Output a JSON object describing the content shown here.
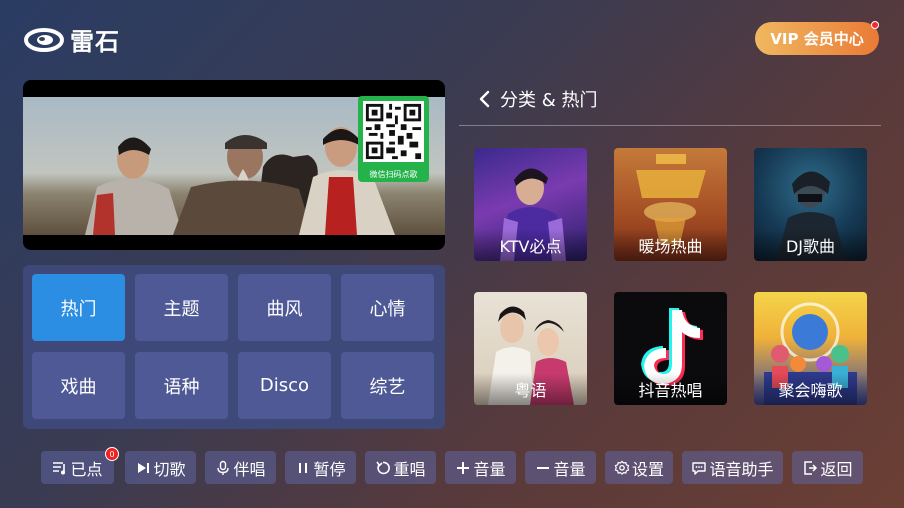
{
  "brand": {
    "name": "雷石"
  },
  "vip": {
    "label": "VIP 会员中心"
  },
  "qr": {
    "caption": "微信扫码点歌"
  },
  "categories": [
    {
      "label": "热门",
      "active": true
    },
    {
      "label": "主题"
    },
    {
      "label": "曲风"
    },
    {
      "label": "心情"
    },
    {
      "label": "戏曲"
    },
    {
      "label": "语种"
    },
    {
      "label": "Disco"
    },
    {
      "label": "综艺"
    }
  ],
  "section": {
    "title": "分类 & 热门"
  },
  "tiles": [
    {
      "label": "KTV必点"
    },
    {
      "label": "暖场热曲"
    },
    {
      "label": "DJ歌曲"
    },
    {
      "label": "粤语"
    },
    {
      "label": "抖音热唱"
    },
    {
      "label": "聚会嗨歌"
    }
  ],
  "toolbar": {
    "queued_label": "已点",
    "queued_count": "0",
    "skip_label": "切歌",
    "accompany_label": "伴唱",
    "pause_label": "暂停",
    "replay_label": "重唱",
    "vol_up_label": "音量",
    "vol_down_label": "音量",
    "settings_label": "设置",
    "voice_label": "语音助手",
    "back_label": "返回"
  },
  "colors": {
    "accent": "#2c8ee3",
    "vip_start": "#f0b860",
    "vip_end": "#ea7a36",
    "badge": "#ee2222",
    "qr_green": "#24b24a"
  }
}
